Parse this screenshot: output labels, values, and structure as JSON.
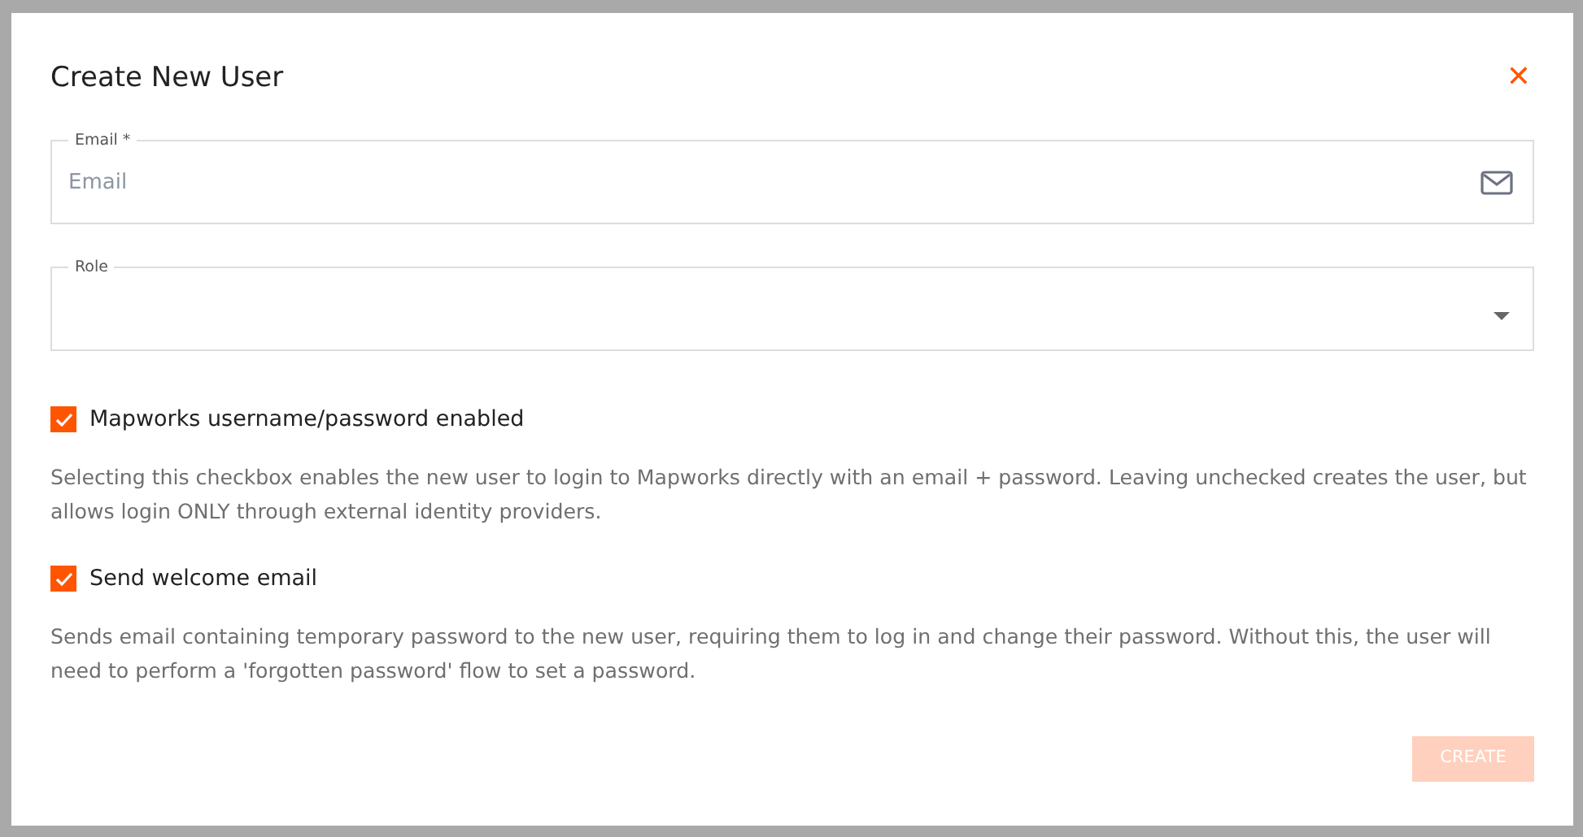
{
  "dialog": {
    "title": "Create New User",
    "close": "✕"
  },
  "fields": [
    {
      "kind": "email",
      "label": "Email *",
      "placeholder": "Email"
    },
    {
      "kind": "select",
      "label": "Role"
    }
  ],
  "options": [
    {
      "label": "Mapworks username/password enabled",
      "checked": true,
      "description": "Selecting this checkbox enables the new user to login to Mapworks directly with an email + password. Leaving unchecked creates the user, but allows login ONLY through external identity providers."
    },
    {
      "label": "Send welcome email",
      "checked": true,
      "description": "Sends email containing temporary password to the new user, requiring them to log in and change their password. Without this, the user will need to perform a 'forgotten password' flow to set a password."
    }
  ],
  "button": {
    "label": "CREATE",
    "disabled": true
  }
}
